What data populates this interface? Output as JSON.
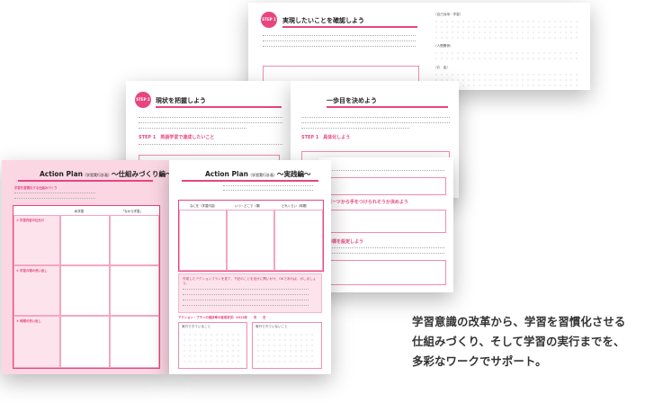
{
  "pages": {
    "back": {
      "badge": "STEP 1",
      "heading": "実現したいことを確認しよう",
      "side_labels": [
        "（自己効用・学習）",
        "（人間関係）",
        "（お　金）"
      ]
    },
    "middle_left": {
      "badge": "STEP 2",
      "heading": "現状を把握しよう",
      "step_label": "STEP 1　英語学習で達成したいこと"
    },
    "middle_right": {
      "heading": "一歩目を決めよう",
      "step_label": "STEP 1　具体化しよう",
      "sub_labels": [
        "パーツから手をつけられそうか決めよう",
        "目標を設定しよう"
      ]
    },
    "front_left": {
      "title": "Action Plan",
      "title_note": "（学習実行計画）",
      "title_suffix": "〜仕組みづくり編〜",
      "intro_label": "学習を習慣化する仕組みづくり",
      "columns": [
        "私学習",
        "「なから学習」"
      ],
      "rows": [
        "① 学習内容の仕分け",
        "② 学習の場の洗い出し",
        "③ 時間の洗い出し"
      ]
    },
    "front_right": {
      "title": "Action Plan",
      "title_note": "（学習実行計画）",
      "title_suffix": "〜実践編〜",
      "columns": [
        "なにを（学習内容）",
        "いつ・どこで（場）",
        "どれくらい（時間）"
      ],
      "panel_text": "作成したアクションプランを見て、下記のことを自分に問いかけ、OKであれば、ボしましょう。",
      "bottom_label": "アクション・プランの進捗率の達成状況：2013年　　月　　日",
      "bottom_boxes": [
        "実行できていること",
        "実行できていないこと"
      ]
    }
  },
  "caption": {
    "lines": [
      "学習意識の改革から、学習を習慣化させる",
      "仕組みづくり、そして学習の実行までを、",
      "多彩なワークでサポート。"
    ]
  }
}
